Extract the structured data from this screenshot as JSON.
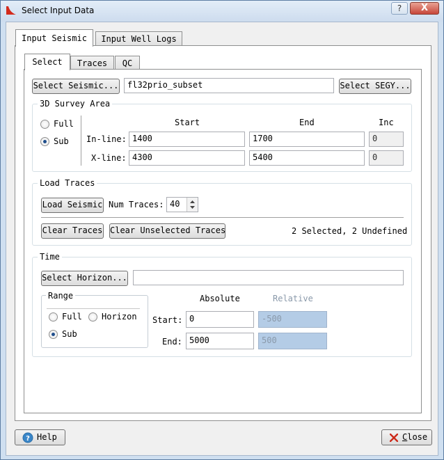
{
  "window": {
    "title": "Select Input Data",
    "help_glyph": "?",
    "close_glyph": "X"
  },
  "outer_tabs": [
    {
      "label": "Input Seismic",
      "active": true
    },
    {
      "label": "Input Well Logs",
      "active": false
    }
  ],
  "inner_tabs": [
    {
      "label": "Select",
      "active": true
    },
    {
      "label": "Traces",
      "active": false
    },
    {
      "label": "QC",
      "active": false
    }
  ],
  "seismic": {
    "select_label": "Select Seismic...",
    "value": "fl32prio_subset",
    "segy_label": "Select SEGY..."
  },
  "survey": {
    "title": "3D Survey Area",
    "mode_options": [
      "Full",
      "Sub"
    ],
    "selected_mode": "Sub",
    "headers": {
      "start": "Start",
      "end": "End",
      "inc": "Inc"
    },
    "inline": {
      "label": "In-line:",
      "start": "1400",
      "end": "1700",
      "inc": "0"
    },
    "xline": {
      "label": "X-line:",
      "start": "4300",
      "end": "5400",
      "inc": "0"
    }
  },
  "load_traces": {
    "title": "Load Traces",
    "load_label": "Load Seismic",
    "num_label": "Num Traces:",
    "num_value": "40",
    "clear_label": "Clear Traces",
    "clear_unselected_label": "Clear Unselected Traces",
    "status": "2 Selected, 2 Undefined"
  },
  "time": {
    "title": "Time",
    "horizon_label": "Select Horizon...",
    "horizon_value": "",
    "range": {
      "title": "Range",
      "options": [
        "Full",
        "Horizon",
        "Sub"
      ],
      "selected": "Sub"
    },
    "absolute_header": "Absolute",
    "relative_header": "Relative",
    "start": {
      "label": "Start:",
      "absolute": "0",
      "relative": "-500"
    },
    "end": {
      "label": "End:",
      "absolute": "5000",
      "relative": "500"
    }
  },
  "footer": {
    "help_label": "Help",
    "close_label": "Close",
    "close_mnemonic_rest": "lose",
    "close_mnemonic": "C"
  },
  "colors": {
    "accent": "#1f4e8c",
    "disabled_field": "#b4cce6",
    "close_x": "#cc2a1a",
    "help_icon": "#3a86c8"
  },
  "icons": {
    "app": "red-seismic-app-icon",
    "help": "help-circle-icon",
    "close": "red-x-icon",
    "spinner": "up-down-arrows-icon"
  }
}
